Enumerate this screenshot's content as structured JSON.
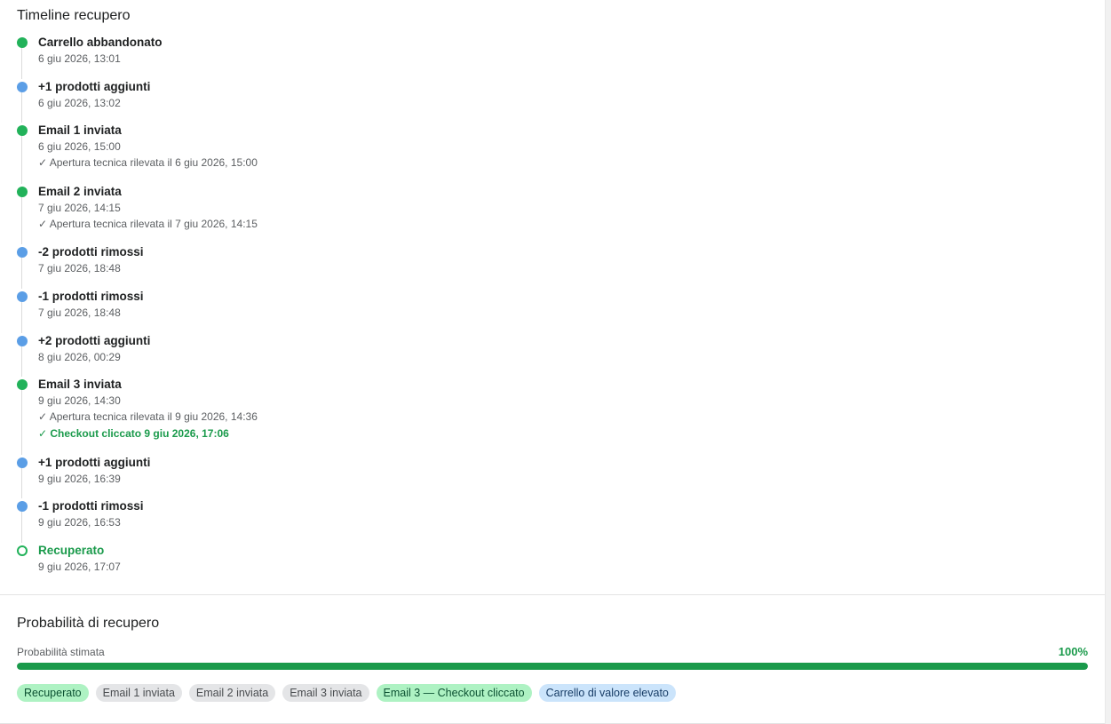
{
  "timeline": {
    "title": "Timeline recupero",
    "events": [
      {
        "title": "Carrello abbandonato",
        "date": "6 giu 2026, 13:01",
        "kind": "green",
        "notes": []
      },
      {
        "title": "+1 prodotti aggiunti",
        "date": "6 giu 2026, 13:02",
        "kind": "blue",
        "notes": []
      },
      {
        "title": "Email 1 inviata",
        "date": "6 giu 2026, 15:00",
        "kind": "green",
        "notes": [
          {
            "text": "✓ Apertura tecnica rilevata il 6 giu 2026, 15:00",
            "style": "muted"
          }
        ]
      },
      {
        "title": "Email 2 inviata",
        "date": "7 giu 2026, 14:15",
        "kind": "green",
        "notes": [
          {
            "text": "✓ Apertura tecnica rilevata il 7 giu 2026, 14:15",
            "style": "muted"
          }
        ]
      },
      {
        "title": "-2 prodotti rimossi",
        "date": "7 giu 2026, 18:48",
        "kind": "blue",
        "notes": []
      },
      {
        "title": "-1 prodotti rimossi",
        "date": "7 giu 2026, 18:48",
        "kind": "blue",
        "notes": []
      },
      {
        "title": "+2 prodotti aggiunti",
        "date": "8 giu 2026, 00:29",
        "kind": "blue",
        "notes": []
      },
      {
        "title": "Email 3 inviata",
        "date": "9 giu 2026, 14:30",
        "kind": "green",
        "notes": [
          {
            "text": "✓ Apertura tecnica rilevata il 9 giu 2026, 14:36",
            "style": "muted"
          },
          {
            "text": "✓ Checkout cliccato 9 giu 2026, 17:06",
            "style": "green"
          }
        ]
      },
      {
        "title": "+1 prodotti aggiunti",
        "date": "9 giu 2026, 16:39",
        "kind": "blue",
        "notes": []
      },
      {
        "title": "-1 prodotti rimossi",
        "date": "9 giu 2026, 16:53",
        "kind": "blue",
        "notes": []
      },
      {
        "title": "Recuperato",
        "date": "9 giu 2026, 17:07",
        "kind": "outline",
        "notes": []
      }
    ]
  },
  "probability": {
    "title": "Probabilità di recupero",
    "label": "Probabilità stimata",
    "value_text": "100%",
    "value": 100,
    "bar_color": "#1a9a4b"
  },
  "badges": [
    {
      "label": "Recuperato",
      "tone": "green"
    },
    {
      "label": "Email 1 inviata",
      "tone": "grey"
    },
    {
      "label": "Email 2 inviata",
      "tone": "grey"
    },
    {
      "label": "Email 3 inviata",
      "tone": "grey"
    },
    {
      "label": "Email 3 — Checkout cliccato",
      "tone": "green"
    },
    {
      "label": "Carrello di valore elevato",
      "tone": "blue"
    }
  ],
  "colors": {
    "green": "#22b25a",
    "blue": "#5b9ee6",
    "text_green": "#1a9a4b"
  }
}
